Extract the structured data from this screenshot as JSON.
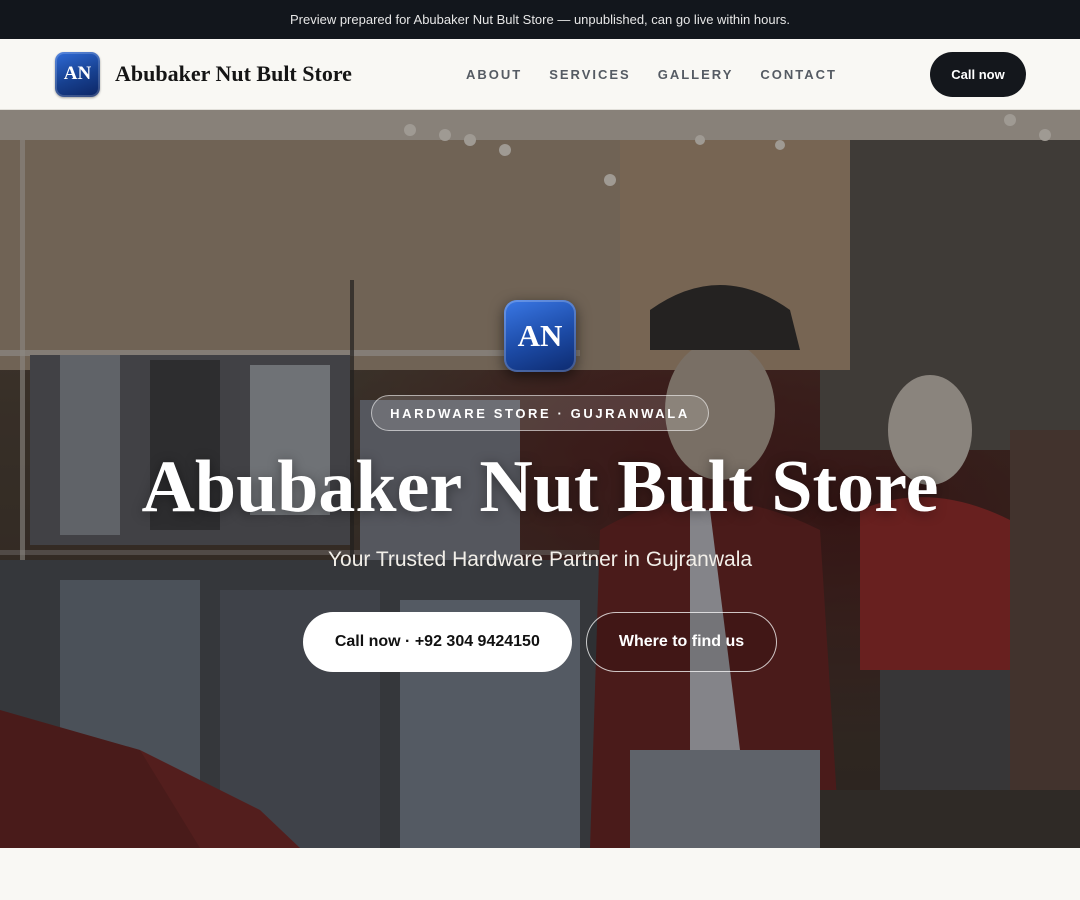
{
  "announcement": "Preview prepared for Abubaker Nut Bult Store — unpublished, can go live within hours.",
  "header": {
    "logo_initials": "AN",
    "brand_name": "Abubaker Nut Bult Store",
    "nav": [
      "ABOUT",
      "SERVICES",
      "GALLERY",
      "CONTACT"
    ],
    "call_label": "Call now"
  },
  "hero": {
    "logo_initials": "AN",
    "tagline": "HARDWARE STORE · GUJRANWALA",
    "title": "Abubaker Nut Bult Store",
    "subtitle": "Your Trusted Hardware Partner in Gujranwala",
    "primary_button": "Call now · +92 304 9424150",
    "secondary_button": "Where to find us",
    "background_image": "store-interior-photo"
  },
  "colors": {
    "announce_bg": "#12161c",
    "accent_dark": "#14171c",
    "logo_blue": "#1c4aa5",
    "page_bg": "#f9f8f4"
  }
}
